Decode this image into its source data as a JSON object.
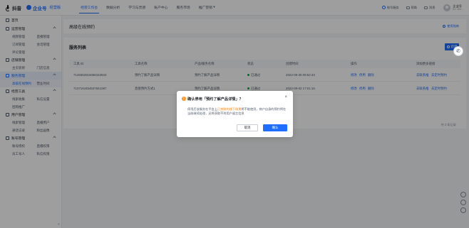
{
  "topbar": {
    "brand1": "抖音",
    "brand2": "企业号",
    "brand2_sub": "经营版",
    "nav": [
      "经营工作台",
      "数据分析",
      "学习与灵感",
      "账户中心",
      "服务市场",
      "推广营销"
    ],
    "nav_active_index": 0,
    "right_items": [
      "账号服务",
      "帮助",
      "消息"
    ],
    "user_name": "企业号",
    "user_id": "ID: 102..."
  },
  "sidebar": {
    "home": "首页",
    "groups": [
      {
        "title": "运营管理",
        "rows": [
          [
            "视频管理",
            "直播管理"
          ],
          [
            "订阅管理",
            "会话管理"
          ],
          [
            "评论管理"
          ]
        ]
      },
      {
        "title": "店铺管理",
        "rows": [
          [
            "主页装修",
            "门店信息"
          ]
        ]
      },
      {
        "title": "服务管理",
        "active": true,
        "rows": [
          [
            "高级在线预约",
            "营业时间"
          ]
        ]
      },
      {
        "title": "经营工具",
        "rows": [
          [
            "线索收集",
            "私信设置"
          ],
          [
            "团购推广"
          ]
        ]
      },
      {
        "title": "用户管理",
        "rows": [
          [
            "线索管理",
            "直播用户"
          ],
          [
            "通话记录",
            "粉丝画像"
          ]
        ]
      },
      {
        "title": "账号管理",
        "rows": [
          [
            "账号授权",
            "直播权限"
          ],
          [
            "员工号人",
            "私信权限"
          ]
        ]
      }
    ],
    "selected_item": "高级在线预约",
    "collapse_label": "«"
  },
  "page": {
    "title": "高级在线预约",
    "help": "使用指南",
    "card_title": "服务列表",
    "new_button": "新建",
    "columns": [
      "工具 ID",
      "工具名称",
      "产品/服务名称",
      "状态",
      "创建时间",
      "操作",
      "添加更多链接"
    ],
    "rows": [
      {
        "id": "7148362816068153843",
        "name": "预约了解产品详情",
        "product": "预约了解产品详情",
        "status": "已通过",
        "time": "2022-09-30 09:52:43",
        "actions": [
          "修改",
          "停用",
          "删除"
        ],
        "links": [
          "去联系推",
          "去定时预约"
        ]
      },
      {
        "id": "7137164454537841087",
        "name": "直接预约方式1",
        "product": "预约了解产品详情",
        "status": "已通过",
        "time": "2022-09-02 17:01:16",
        "actions": [
          "修改",
          "停用",
          "删除"
        ],
        "links": [
          "去联系推",
          "去定时预约"
        ]
      }
    ],
    "pager": "共 2 条记录"
  },
  "modal": {
    "title": "确认停用「预约了解产品详情」？",
    "body_prefix": "停用后该服务在平台上",
    "body_highlight": "已关联的线下场景",
    "body_suffix": "将不能使用，商户自身的预约将在当前继续处理，还将获取不到用户留言信息",
    "cancel": "取消",
    "confirm": "确认"
  },
  "colors": {
    "accent": "#1e6fff",
    "warning": "#ff9a2e",
    "success": "#00b42a"
  }
}
